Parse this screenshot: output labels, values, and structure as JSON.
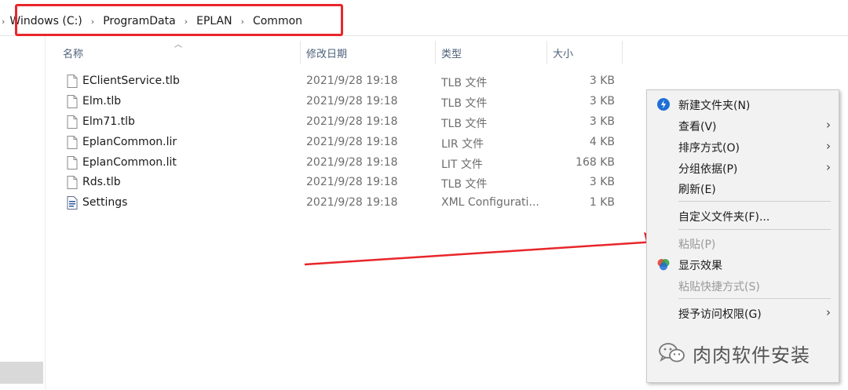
{
  "address": {
    "crumbs": [
      "Windows (C:)",
      "ProgramData",
      "EPLAN",
      "Common"
    ],
    "separator": "›",
    "highlight_color": "#e8262a"
  },
  "columns": {
    "name": "名称",
    "date": "修改日期",
    "type": "类型",
    "size": "大小"
  },
  "files": [
    {
      "name": "EClientService.tlb",
      "date": "2021/9/28 19:18",
      "type": "TLB 文件",
      "size": "3 KB",
      "icon": "file-icon"
    },
    {
      "name": "Elm.tlb",
      "date": "2021/9/28 19:18",
      "type": "TLB 文件",
      "size": "3 KB",
      "icon": "file-icon"
    },
    {
      "name": "Elm71.tlb",
      "date": "2021/9/28 19:18",
      "type": "TLB 文件",
      "size": "3 KB",
      "icon": "file-icon"
    },
    {
      "name": "EplanCommon.lir",
      "date": "2021/9/28 19:18",
      "type": "LIR 文件",
      "size": "4 KB",
      "icon": "file-icon"
    },
    {
      "name": "EplanCommon.lit",
      "date": "2021/9/28 19:18",
      "type": "LIT 文件",
      "size": "168 KB",
      "icon": "file-icon"
    },
    {
      "name": "Rds.tlb",
      "date": "2021/9/28 19:18",
      "type": "TLB 文件",
      "size": "3 KB",
      "icon": "file-icon"
    },
    {
      "name": "Settings",
      "date": "2021/9/28 19:18",
      "type": "XML Configurati...",
      "size": "1 KB",
      "icon": "xml-config-icon"
    }
  ],
  "context_menu": {
    "items": [
      {
        "label": "新建文件夹(N)",
        "icon": "new-folder-icon"
      },
      {
        "label": "查看(V)",
        "submenu": true
      },
      {
        "label": "排序方式(O)",
        "submenu": true
      },
      {
        "label": "分组依据(P)",
        "submenu": true
      },
      {
        "label": "刷新(E)"
      },
      {
        "label": "自定义文件夹(F)..."
      },
      {
        "label": "粘贴(P)",
        "disabled": true
      },
      {
        "label": "显示效果",
        "icon": "display-effect-icon"
      },
      {
        "label": "粘贴快捷方式(S)",
        "disabled": true
      },
      {
        "label": "授予访问权限(G)",
        "submenu": true
      }
    ],
    "chevron": "›"
  },
  "watermark": {
    "text": "肉肉软件安装",
    "icon": "wechat-icon"
  },
  "arrow_color": "#e8262a"
}
